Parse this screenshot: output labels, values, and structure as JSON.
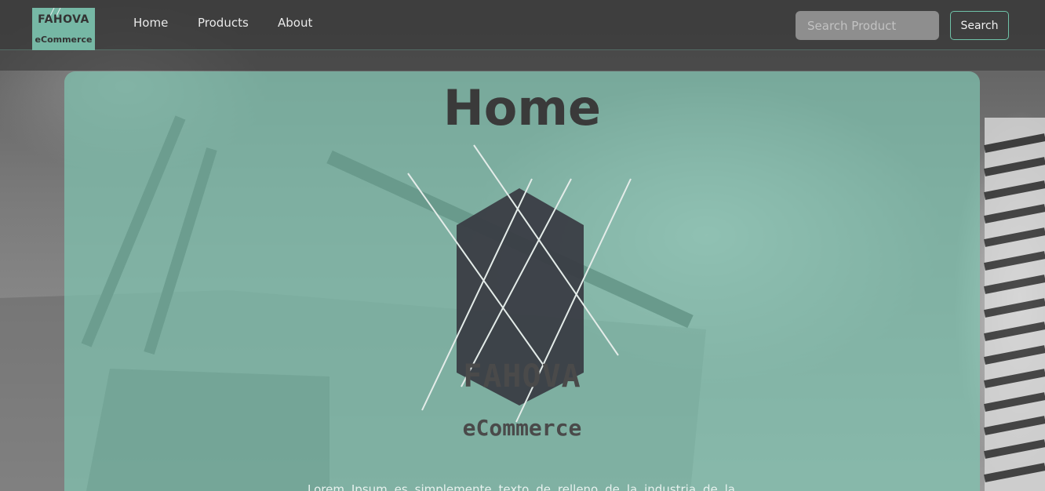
{
  "navbar": {
    "logo": {
      "line1": "FAHOVA",
      "line2": "eCommerce"
    },
    "links": [
      {
        "label": "Home"
      },
      {
        "label": "Products"
      },
      {
        "label": "About"
      }
    ],
    "search": {
      "placeholder": "Search Product",
      "value": "",
      "button_label": "Search"
    }
  },
  "main": {
    "title": "Home",
    "brand": {
      "name": "FAHOVA",
      "subtitle": "eCommerce",
      "icon": "hexagon-logo-icon"
    },
    "description": "Lorem Ipsum es simplemente texto de relleno de la industria de la"
  },
  "colors": {
    "accent": "#76b8a5",
    "card": "#7fc4b0",
    "navbar": "#3a3a3a",
    "hexagon": "#3a3d45"
  }
}
